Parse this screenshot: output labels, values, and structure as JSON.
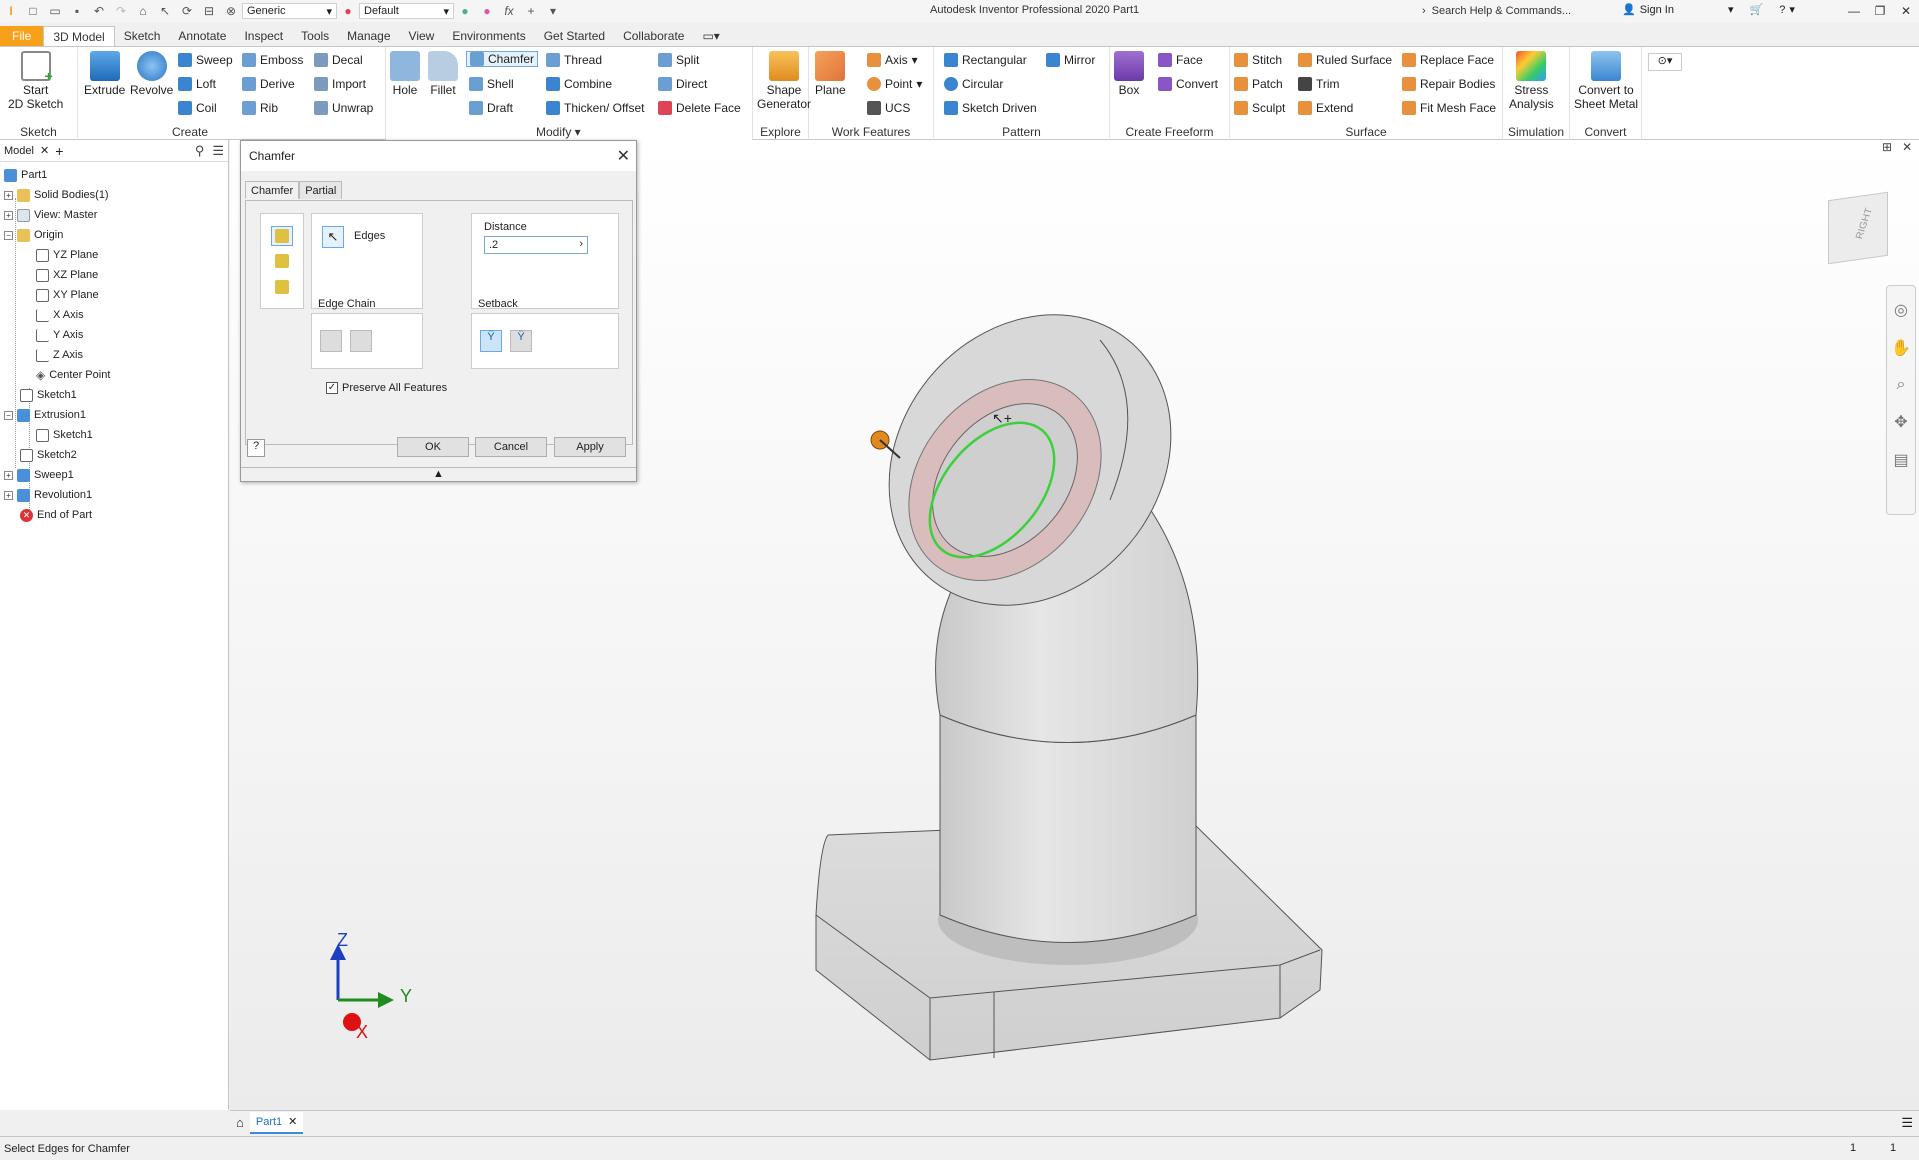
{
  "titlebar": {
    "app_title": "Autodesk Inventor Professional 2020   Part1",
    "material_combo": "Generic",
    "appearance_combo": "Default",
    "search_placeholder": "Search Help & Commands...",
    "sign_in": "Sign In"
  },
  "menu_tabs": [
    "File",
    "3D Model",
    "Sketch",
    "Annotate",
    "Inspect",
    "Tools",
    "Manage",
    "View",
    "Environments",
    "Get Started",
    "Collaborate"
  ],
  "ribbon": {
    "sketch": {
      "label": "Sketch",
      "start_sketch": "Start\n2D Sketch"
    },
    "create": {
      "label": "Create",
      "extrude": "Extrude",
      "revolve": "Revolve",
      "sweep": "Sweep",
      "loft": "Loft",
      "coil": "Coil",
      "emboss": "Emboss",
      "derive": "Derive",
      "rib": "Rib",
      "decal": "Decal",
      "import": "Import",
      "unwrap": "Unwrap"
    },
    "modify": {
      "label": "Modify",
      "hole": "Hole",
      "fillet": "Fillet",
      "chamfer": "Chamfer",
      "shell": "Shell",
      "draft": "Draft",
      "thread": "Thread",
      "combine": "Combine",
      "thicken": "Thicken/ Offset",
      "split": "Split",
      "direct": "Direct",
      "delete_face": "Delete Face"
    },
    "explore": {
      "label": "Explore",
      "shape_generator": "Shape\nGenerator"
    },
    "work_features": {
      "label": "Work Features",
      "plane": "Plane",
      "axis": "Axis",
      "point": "Point",
      "ucs": "UCS"
    },
    "pattern": {
      "label": "Pattern",
      "rectangular": "Rectangular",
      "circular": "Circular",
      "sketch_driven": "Sketch Driven",
      "mirror": "Mirror"
    },
    "create_freeform": {
      "label": "Create Freeform",
      "box": "Box",
      "face": "Face",
      "convert": "Convert"
    },
    "surface": {
      "label": "Surface",
      "stitch": "Stitch",
      "patch": "Patch",
      "sculpt": "Sculpt",
      "ruled_surface": "Ruled Surface",
      "trim": "Trim",
      "extend": "Extend",
      "replace_face": "Replace Face",
      "repair_bodies": "Repair Bodies",
      "fit_mesh_face": "Fit Mesh Face"
    },
    "simulation": {
      "label": "Simulation",
      "stress_analysis": "Stress\nAnalysis"
    },
    "convert": {
      "label": "Convert",
      "sheet_metal": "Convert to\nSheet Metal"
    }
  },
  "browser": {
    "tab": "Model",
    "tree": [
      {
        "label": "Part1"
      },
      {
        "label": "Solid Bodies(1)"
      },
      {
        "label": "View: Master"
      },
      {
        "label": "Origin"
      },
      {
        "label": "YZ Plane"
      },
      {
        "label": "XZ Plane"
      },
      {
        "label": "XY Plane"
      },
      {
        "label": "X Axis"
      },
      {
        "label": "Y Axis"
      },
      {
        "label": "Z Axis"
      },
      {
        "label": "Center Point"
      },
      {
        "label": "Sketch1"
      },
      {
        "label": "Extrusion1"
      },
      {
        "label": "Sketch1"
      },
      {
        "label": "Sketch2"
      },
      {
        "label": "Sweep1"
      },
      {
        "label": "Revolution1"
      },
      {
        "label": "End of Part"
      }
    ]
  },
  "dialog": {
    "title": "Chamfer",
    "tabs": [
      "Chamfer",
      "Partial"
    ],
    "edges_label": "Edges",
    "distance_label": "Distance",
    "distance_value": ".2",
    "edge_chain_label": "Edge Chain",
    "setback_label": "Setback",
    "preserve_label": "Preserve All Features",
    "preserve_checked": true,
    "ok": "OK",
    "cancel": "Cancel",
    "apply": "Apply"
  },
  "viewcube_face": "RIGHT",
  "triad": {
    "z": "Z",
    "y": "Y",
    "x": "X"
  },
  "doc_tab": "Part1",
  "status": {
    "message": "Select Edges for Chamfer",
    "count1": "1",
    "count2": "1"
  }
}
